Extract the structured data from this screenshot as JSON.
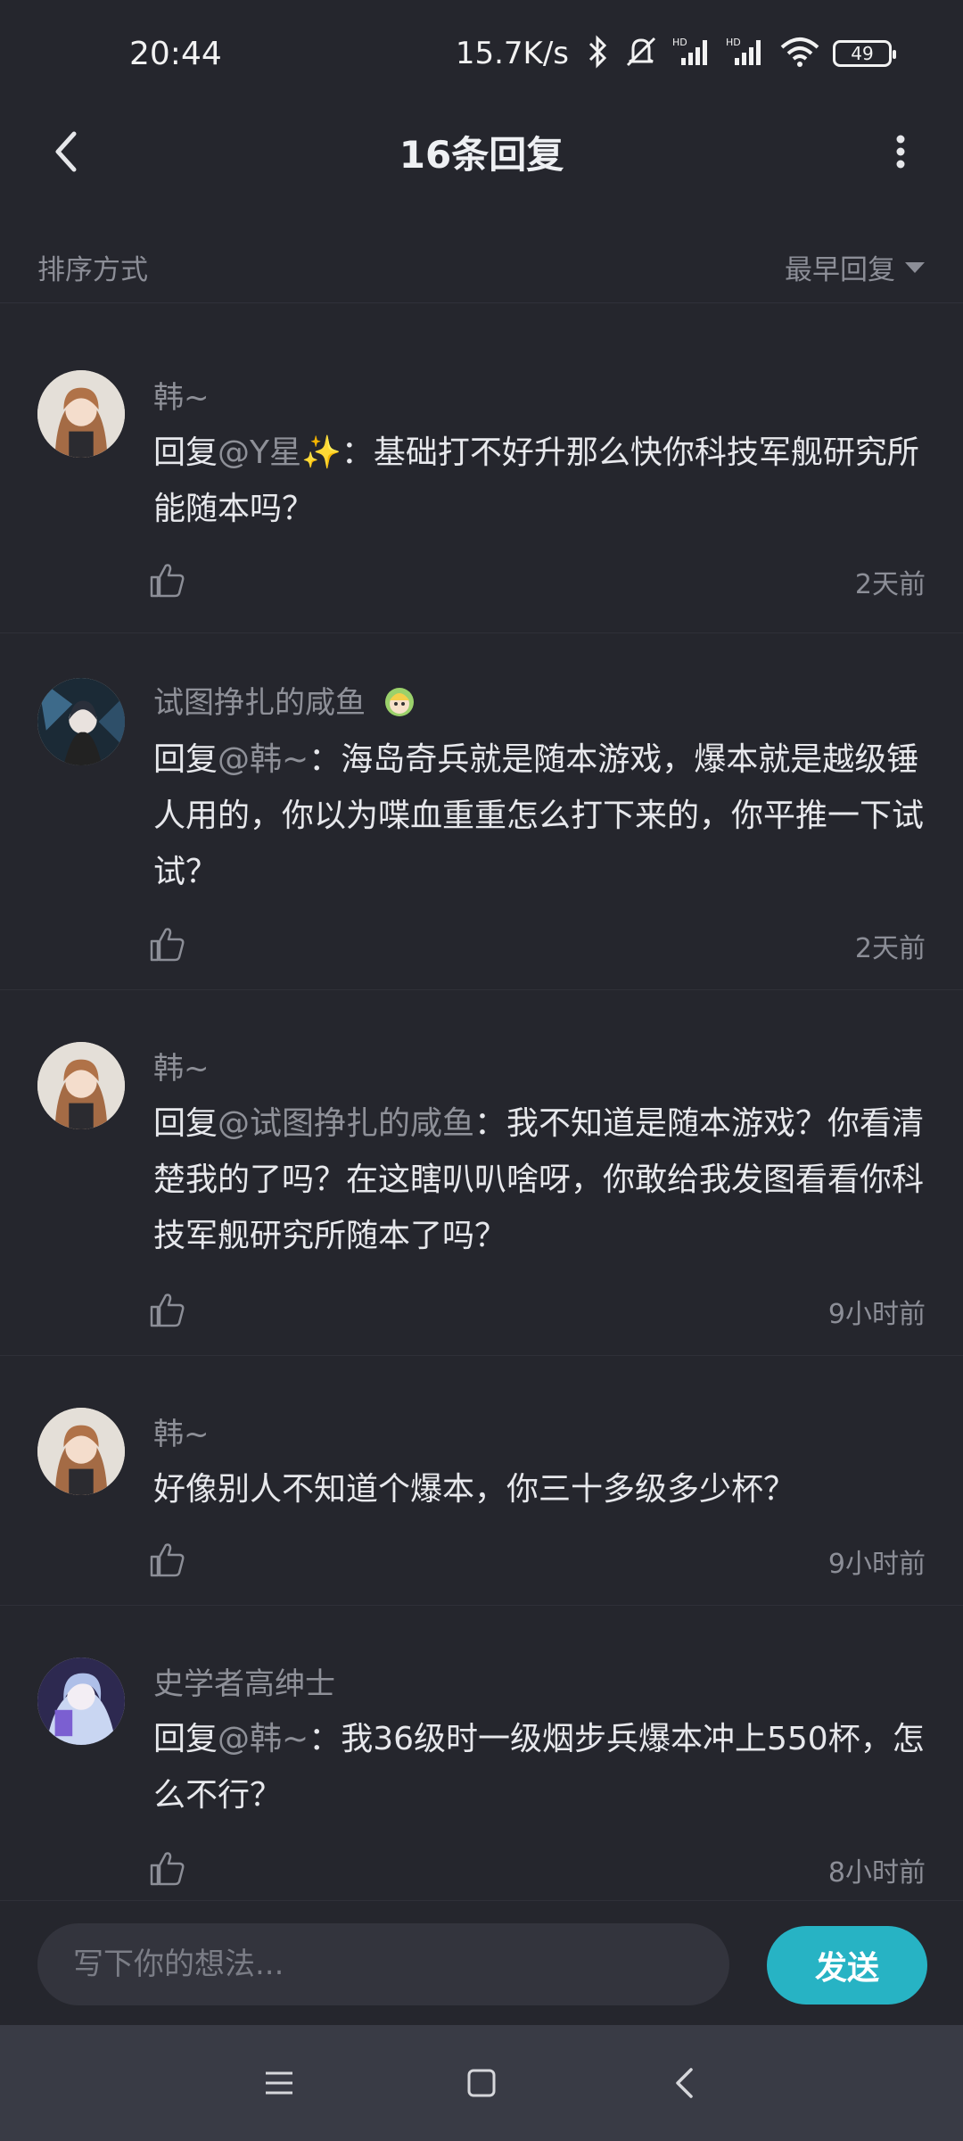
{
  "status_bar": {
    "time": "20:44",
    "network_speed": "15.7K/s",
    "battery": "49",
    "icons": [
      "bluetooth-icon",
      "mute-icon",
      "signal-hd-icon",
      "signal-hd-icon",
      "wifi-icon",
      "battery-icon"
    ]
  },
  "header": {
    "title": "16条回复",
    "back_icon": "chevron-left-icon",
    "more_icon": "more-vertical-icon"
  },
  "sort": {
    "label": "排序方式",
    "selected": "最早回复"
  },
  "comments": [
    {
      "name": "韩~",
      "prefix": "回复",
      "mention": "@Y星✨",
      "text": "：基础打不好升那么快你科技军舰研究所能随本吗？",
      "time": "2天前"
    },
    {
      "name": "试图挣扎的咸鱼",
      "prefix": "回复",
      "mention": "@韩~",
      "text": "：海岛奇兵就是随本游戏，爆本就是越级锤人用的，你以为喋血重重怎么打下来的，你平推一下试试？",
      "time": "2天前"
    },
    {
      "name": "韩~",
      "prefix": "回复",
      "mention": "@试图挣扎的咸鱼",
      "text": "：我不知道是随本游戏？你看清楚我的了吗？在这瞎叭叭啥呀，你敢给我发图看看你科技军舰研究所随本了吗？",
      "time": "9小时前"
    },
    {
      "name": "韩~",
      "prefix": "",
      "mention": "",
      "text": "好像别人不知道个爆本，你三十多级多少杯？",
      "time": "9小时前"
    },
    {
      "name": "史学者高绅士",
      "prefix": "回复",
      "mention": "@韩~",
      "text": "：我36级时一级烟步兵爆本冲上550杯，怎么不行？",
      "time": "8小时前"
    }
  ],
  "input": {
    "placeholder": "写下你的想法...",
    "send_label": "发送"
  },
  "nav": {
    "icons": [
      "menu-icon",
      "home-square-icon",
      "back-triangle-icon"
    ]
  }
}
